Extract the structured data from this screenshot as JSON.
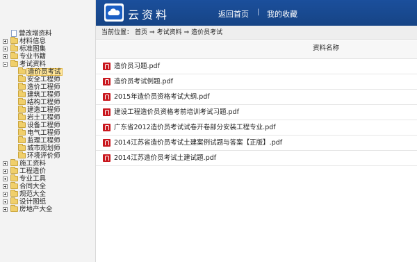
{
  "header": {
    "site_title": "云资料",
    "nav_home": "返回首页",
    "nav_separator": "|",
    "nav_favorites": "我的收藏",
    "bar_color": "#1b4f9c"
  },
  "breadcrumb": {
    "prefix": "当前位置：",
    "items": [
      "首页",
      "⇒",
      "考试资料",
      "⇒",
      "造价员考试"
    ]
  },
  "file_list": {
    "column_header": "资料名称",
    "files": [
      "造价员习题.pdf",
      "造价员考试例题.pdf",
      "2015年造价员资格考试大纲.pdf",
      "建设工程造价员资格考前培训考试习题.pdf",
      "广东省2012造价员考试试卷开卷部分安装工程专业.pdf",
      "2014江苏省造价员考试土建案例试题与答案【正版】.pdf",
      "2014江苏造价员考试土建试题.pdf"
    ]
  },
  "sidebar": {
    "items": [
      {
        "label": "营改增资料",
        "kind": "doc",
        "level": 1
      },
      {
        "label": "材料信息",
        "kind": "folder",
        "expander": "plus",
        "level": 0
      },
      {
        "label": "标准图集",
        "kind": "folder",
        "expander": "plus",
        "level": 0
      },
      {
        "label": "专业书籍",
        "kind": "folder",
        "expander": "plus",
        "level": 0
      },
      {
        "label": "考试资料",
        "kind": "folder",
        "expander": "minus",
        "level": 0
      },
      {
        "label": "造价员考试",
        "kind": "folder",
        "level": 1,
        "selected": true
      },
      {
        "label": "安全工程师",
        "kind": "folder",
        "level": 1
      },
      {
        "label": "造价工程师",
        "kind": "folder",
        "level": 1
      },
      {
        "label": "建筑工程师",
        "kind": "folder",
        "level": 1
      },
      {
        "label": "结构工程师",
        "kind": "folder",
        "level": 1
      },
      {
        "label": "建造工程师",
        "kind": "folder",
        "level": 1
      },
      {
        "label": "岩土工程师",
        "kind": "folder",
        "level": 1
      },
      {
        "label": "设备工程师",
        "kind": "folder",
        "level": 1
      },
      {
        "label": "电气工程师",
        "kind": "folder",
        "level": 1
      },
      {
        "label": "监理工程师",
        "kind": "folder",
        "level": 1
      },
      {
        "label": "城市规划师",
        "kind": "folder",
        "level": 1
      },
      {
        "label": "环境评价师",
        "kind": "folder",
        "level": 1
      },
      {
        "label": "施工资料",
        "kind": "folder",
        "expander": "plus",
        "level": 0
      },
      {
        "label": "工程造价",
        "kind": "folder",
        "expander": "plus",
        "level": 0
      },
      {
        "label": "专业工具",
        "kind": "folder",
        "expander": "plus",
        "level": 0
      },
      {
        "label": "合同大全",
        "kind": "folder",
        "expander": "plus",
        "level": 0
      },
      {
        "label": "规范大全",
        "kind": "folder",
        "expander": "plus",
        "level": 0
      },
      {
        "label": "设计图纸",
        "kind": "folder",
        "expander": "plus",
        "level": 0
      },
      {
        "label": "房地产大全",
        "kind": "folder",
        "expander": "plus",
        "level": 0
      }
    ]
  }
}
